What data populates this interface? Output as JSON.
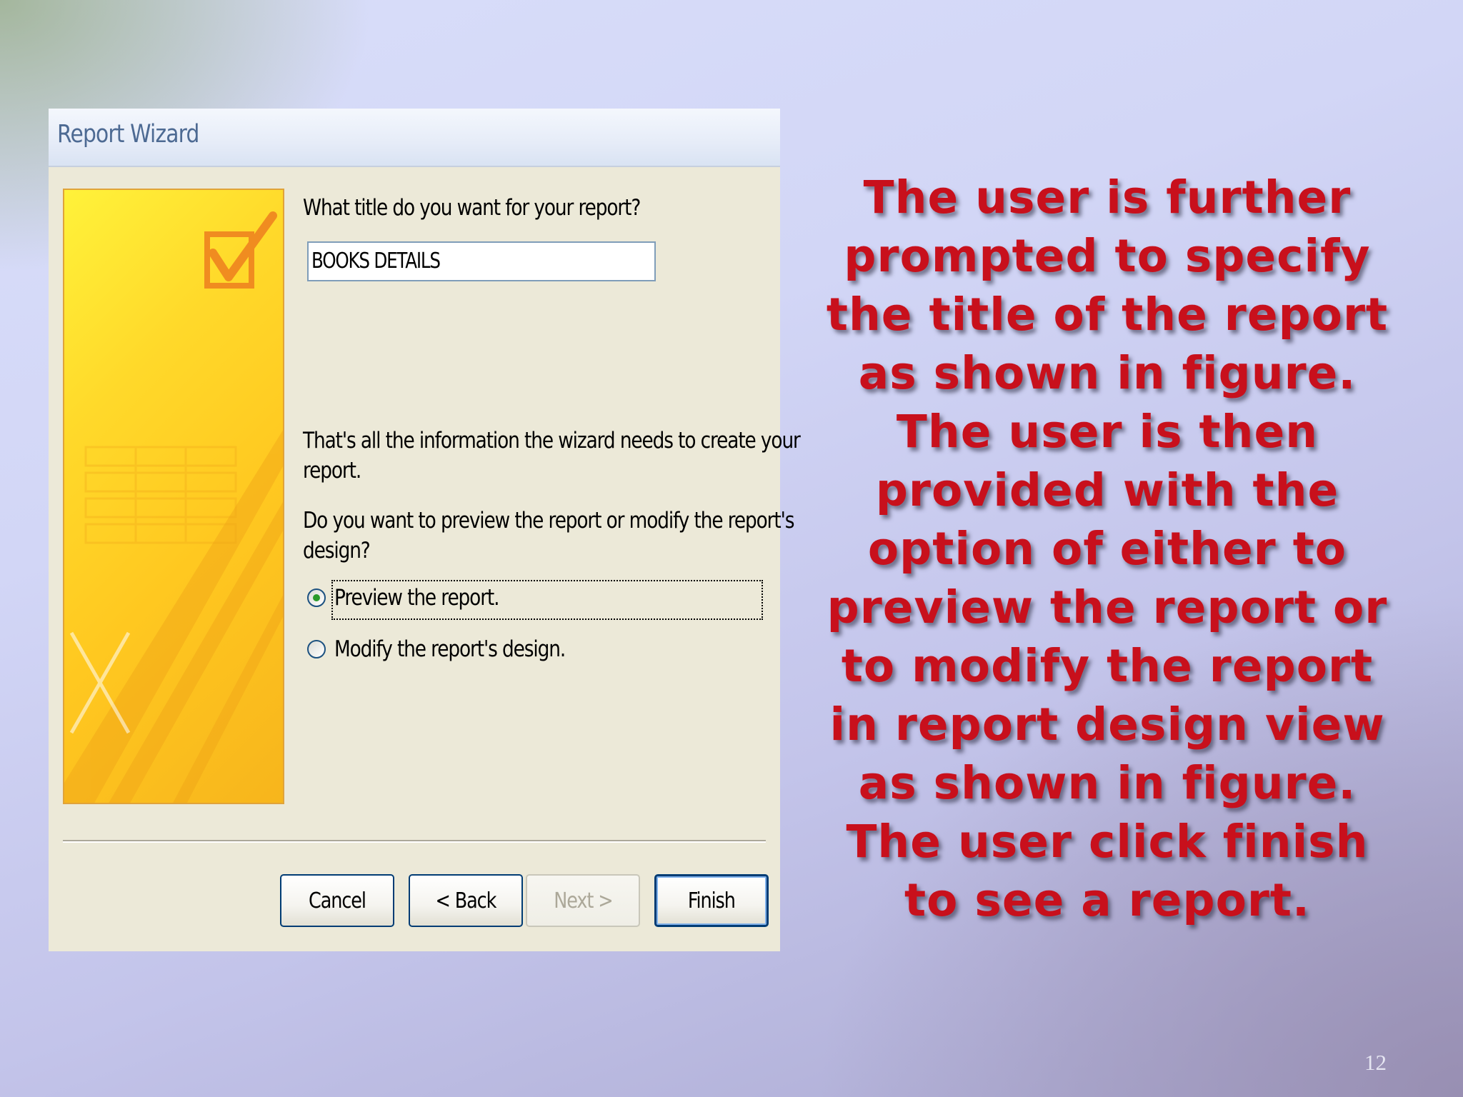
{
  "dialog": {
    "window_title": "Report Wizard",
    "title_question": "What title do you want for your report?",
    "title_value": "BOOKS DETAILS",
    "info_line1": "That's all the information the wizard needs to create your",
    "info_line2": "report.",
    "preview_question_line1": "Do you want to preview the report or modify the report's",
    "preview_question_line2": "design?",
    "options": [
      {
        "label": "Preview the report.",
        "selected": true
      },
      {
        "label": "Modify the report's design.",
        "selected": false
      }
    ],
    "buttons": {
      "cancel": "Cancel",
      "back": "< Back",
      "next": "Next >",
      "finish": "Finish"
    },
    "next_enabled": false,
    "icons": [
      "checkmark-graphic"
    ]
  },
  "description": "The user is further prompted to specify the title of the report as shown in figure. The user is then provided with the option of either to preview the report or to modify the report in report design view as shown in figure. The user click finish to see a report.",
  "slide_number": "12",
  "colors": {
    "description_text": "#c8101c",
    "dialog_background": "#ece9d8",
    "side_panel": "#ffd92a"
  }
}
